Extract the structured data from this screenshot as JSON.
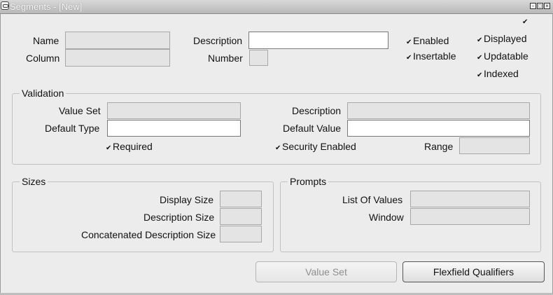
{
  "window": {
    "title": "Segments - [New]",
    "controls": {
      "minimize": "-",
      "maximize": "□",
      "close": "×"
    }
  },
  "corner_check": "✔",
  "segment": {
    "name_label": "Name",
    "column_label": "Column",
    "description_label": "Description",
    "number_label": "Number",
    "name_value": "",
    "column_value": "",
    "description_value": "",
    "number_value": ""
  },
  "flags": [
    {
      "label": "Enabled",
      "checked": true
    },
    {
      "label": "Insertable",
      "checked": true
    },
    {
      "label": "Displayed",
      "checked": true
    },
    {
      "label": "Updatable",
      "checked": true
    },
    {
      "label": "Indexed",
      "checked": true
    }
  ],
  "validation": {
    "title": "Validation",
    "value_set_label": "Value Set",
    "default_type_label": "Default Type",
    "description_label": "Description",
    "default_value_label": "Default Value",
    "range_label": "Range",
    "required_label": "Required",
    "security_enabled_label": "Security Enabled",
    "required_checked": true,
    "security_enabled_checked": true
  },
  "sizes": {
    "title": "Sizes",
    "display_size_label": "Display Size",
    "description_size_label": "Description Size",
    "concatenated_size_label": "Concatenated Description Size"
  },
  "prompts": {
    "title": "Prompts",
    "list_of_values_label": "List Of Values",
    "window_label": "Window"
  },
  "buttons": {
    "value_set": "Value Set",
    "flexfield_qualifiers": "Flexfield Qualifiers"
  },
  "check_glyph": "✔"
}
